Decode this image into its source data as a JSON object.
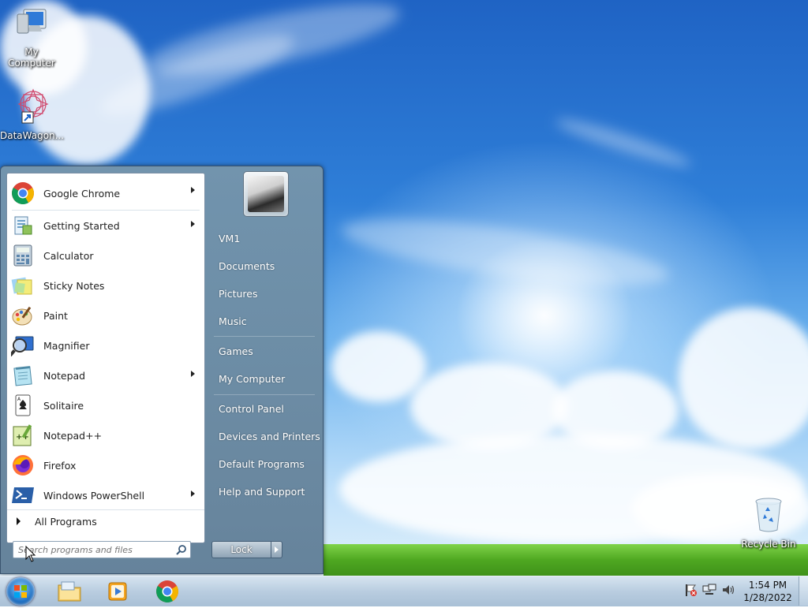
{
  "desktop": {
    "icons": [
      {
        "label": "My Computer",
        "icon": "monitor-icon"
      },
      {
        "label": "DataWagon...",
        "icon": "datawagon-shortcut-icon"
      },
      {
        "label": "Recycle Bin",
        "icon": "recycle-bin-icon"
      }
    ]
  },
  "start_menu": {
    "programs": [
      {
        "label": "Google Chrome",
        "icon": "chrome-icon",
        "has_submenu": true
      },
      {
        "label": "Getting Started",
        "icon": "getting-started-icon",
        "has_submenu": true
      },
      {
        "label": "Calculator",
        "icon": "calculator-icon",
        "has_submenu": false
      },
      {
        "label": "Sticky Notes",
        "icon": "sticky-notes-icon",
        "has_submenu": false
      },
      {
        "label": "Paint",
        "icon": "paint-icon",
        "has_submenu": false
      },
      {
        "label": "Magnifier",
        "icon": "magnifier-icon",
        "has_submenu": false
      },
      {
        "label": "Notepad",
        "icon": "notepad-icon",
        "has_submenu": true
      },
      {
        "label": "Solitaire",
        "icon": "solitaire-icon",
        "has_submenu": false
      },
      {
        "label": "Notepad++",
        "icon": "notepadpp-icon",
        "has_submenu": false
      },
      {
        "label": "Firefox",
        "icon": "firefox-icon",
        "has_submenu": false
      },
      {
        "label": "Windows PowerShell",
        "icon": "powershell-icon",
        "has_submenu": true
      }
    ],
    "all_programs_label": "All Programs",
    "search_placeholder": "Search programs and files",
    "right_items": [
      "VM1",
      "Documents",
      "Pictures",
      "Music",
      "Games",
      "My Computer",
      "Control Panel",
      "Devices and Printers",
      "Default Programs",
      "Help and Support"
    ],
    "lock_label": "Lock"
  },
  "taskbar": {
    "apps": [
      "file-explorer-icon",
      "media-player-icon",
      "chrome-icon"
    ],
    "tray_icons": [
      "action-center-flag-icon",
      "network-icon",
      "volume-icon"
    ],
    "time": "1:54 PM",
    "date": "1/28/2022"
  },
  "colors": {
    "start_menu_frame": "#6f8ca3",
    "sky_top": "#1f63c4",
    "taskbar": "#b9cde0"
  }
}
